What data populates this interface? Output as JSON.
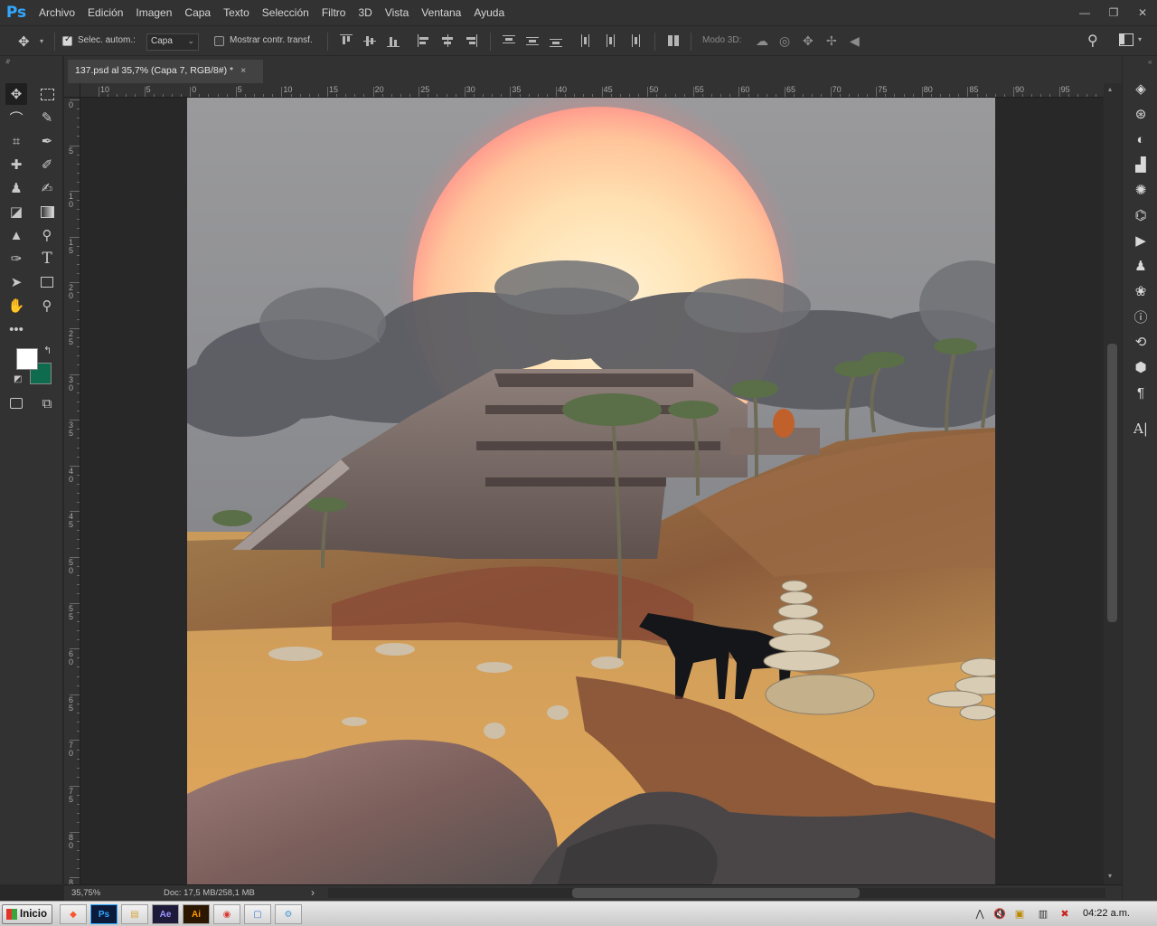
{
  "app": {
    "logo": "Ps"
  },
  "menu": [
    "Archivo",
    "Edición",
    "Imagen",
    "Capa",
    "Texto",
    "Selección",
    "Filtro",
    "3D",
    "Vista",
    "Ventana",
    "Ayuda"
  ],
  "window_controls": {
    "minimize": "—",
    "restore": "❐",
    "close": "✕"
  },
  "options": {
    "auto_select_label": "Selec. autom.:",
    "auto_select_checked": true,
    "auto_select_target": "Capa",
    "show_transform_label": "Mostrar contr. transf.",
    "show_transform_checked": false,
    "mode_3d_label": "Modo 3D:"
  },
  "document": {
    "tab_title": "137.psd al 35,7% (Capa 7, RGB/8#) *",
    "close": "×"
  },
  "ruler": {
    "h_ticks": [
      "10",
      "5",
      "0",
      "5",
      "10",
      "15",
      "20",
      "25",
      "30",
      "35",
      "40",
      "45",
      "50",
      "55",
      "60",
      "65",
      "70",
      "75",
      "80",
      "85",
      "90",
      "95"
    ],
    "v_ticks": [
      "0",
      "5",
      "1 0",
      "1 5",
      "2 0",
      "2 5",
      "3 0",
      "3 5",
      "4 0",
      "4 5",
      "5 0",
      "5 5",
      "6 0",
      "6 5",
      "7 0",
      "7 5",
      "8 0",
      "8 5"
    ]
  },
  "status": {
    "zoom": "35,75%",
    "doc_size": "Doc: 17,5 MB/258,1 MB",
    "arrow": "›"
  },
  "taskbar": {
    "start_label": "Inicio",
    "apps": [
      "brave",
      "Ps",
      "explorer",
      "Ae",
      "Ai",
      "chrome",
      "notepad",
      "settings"
    ],
    "clock": "04:22 a.m."
  },
  "colors": {
    "foreground": "#ffffff",
    "background": "#0f6b4e",
    "ps_blue": "#31a8ff"
  }
}
